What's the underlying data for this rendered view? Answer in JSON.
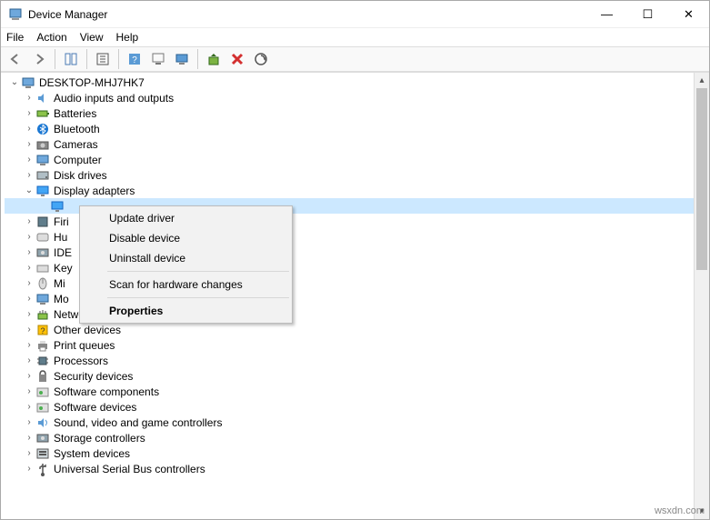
{
  "window": {
    "title": "Device Manager",
    "min": "—",
    "max": "☐",
    "close": "✕"
  },
  "menu": {
    "file": "File",
    "action": "Action",
    "view": "View",
    "help": "Help"
  },
  "toolbar_icons": {
    "back": "back-icon",
    "fwd": "forward-icon",
    "list": "list-icon",
    "props": "props-icon",
    "help": "help-icon",
    "refresh": "refresh-icon",
    "monitor": "monitor-icon",
    "scan1": "scan-icon",
    "delete": "delete-icon",
    "scan2": "scan-update-icon"
  },
  "root": "DESKTOP-MHJ7HK7",
  "tree": [
    {
      "label": "Audio inputs and outputs",
      "exp": "right"
    },
    {
      "label": "Batteries",
      "exp": "right"
    },
    {
      "label": "Bluetooth",
      "exp": "right"
    },
    {
      "label": "Cameras",
      "exp": "right"
    },
    {
      "label": "Computer",
      "exp": "right"
    },
    {
      "label": "Disk drives",
      "exp": "right"
    },
    {
      "label": "Display adapters",
      "exp": "down"
    },
    {
      "label": "",
      "exp": "",
      "child": true
    },
    {
      "label": "Firi",
      "exp": "right",
      "trunc": true
    },
    {
      "label": "Hu",
      "exp": "right",
      "trunc": true
    },
    {
      "label": "IDE",
      "exp": "right",
      "trunc": true
    },
    {
      "label": "Key",
      "exp": "right",
      "trunc": true
    },
    {
      "label": "Mi",
      "exp": "right",
      "trunc": true
    },
    {
      "label": "Mo",
      "exp": "right",
      "trunc": true
    },
    {
      "label": "Network adapters",
      "exp": "right"
    },
    {
      "label": "Other devices",
      "exp": "right"
    },
    {
      "label": "Print queues",
      "exp": "right"
    },
    {
      "label": "Processors",
      "exp": "right"
    },
    {
      "label": "Security devices",
      "exp": "right"
    },
    {
      "label": "Software components",
      "exp": "right"
    },
    {
      "label": "Software devices",
      "exp": "right"
    },
    {
      "label": "Sound, video and game controllers",
      "exp": "right"
    },
    {
      "label": "Storage controllers",
      "exp": "right"
    },
    {
      "label": "System devices",
      "exp": "right"
    },
    {
      "label": "Universal Serial Bus controllers",
      "exp": "right"
    }
  ],
  "ctx": {
    "update": "Update driver",
    "disable": "Disable device",
    "uninstall": "Uninstall device",
    "scan": "Scan for hardware changes",
    "props": "Properties"
  },
  "watermark": "wsxdn.com"
}
